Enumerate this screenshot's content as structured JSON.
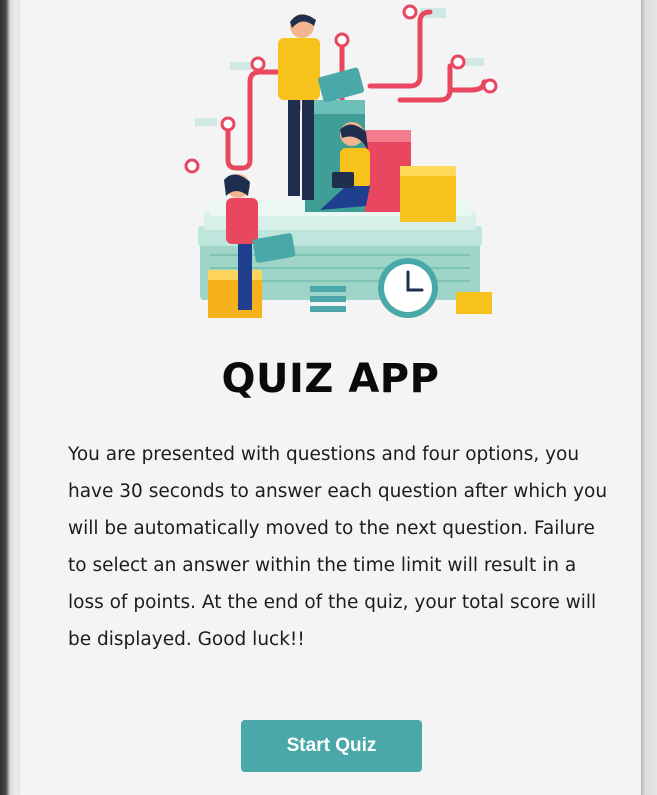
{
  "app": {
    "title": "QUIZ APP",
    "description": "You are presented with questions and four options, you have 30 seconds to answer each question after which you will be automatically moved to the next question. Failure to select an answer within the time limit will result in a loss of points. At the end of the quiz, your total score will be displayed. Good luck!!",
    "start_button": "Start Quiz"
  },
  "illustration": {
    "icon": "quiz-team-illustration-icon",
    "colors": {
      "teal": "#4aa8a8",
      "pink": "#e8475f",
      "yellow": "#f7c21b",
      "mint": "#a9ddd0",
      "navy": "#1f2d4e"
    }
  },
  "colors": {
    "button": "#4aa8a8",
    "card_background": "#f4f4f4",
    "text": "#1c1c1c"
  }
}
